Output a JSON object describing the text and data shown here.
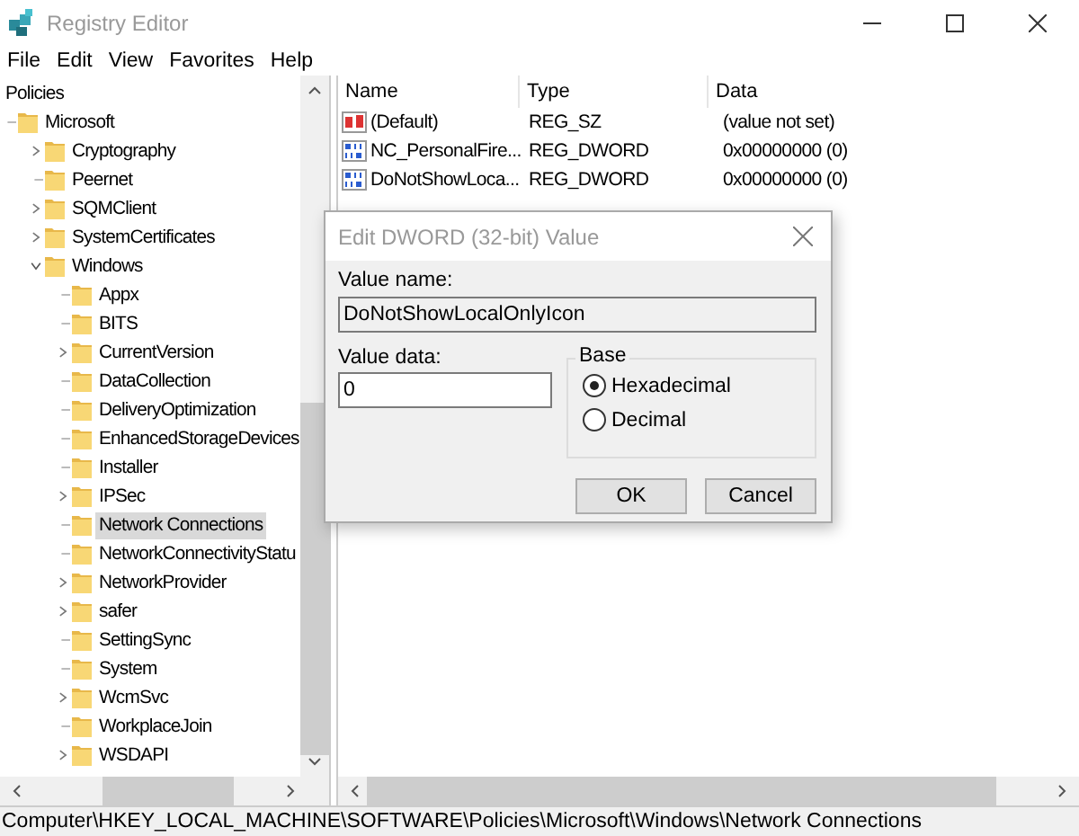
{
  "window": {
    "title": "Registry Editor"
  },
  "menu": [
    "File",
    "Edit",
    "View",
    "Favorites",
    "Help"
  ],
  "tree": [
    {
      "label": "Policies",
      "selected": false,
      "children": [
        {
          "label": "Microsoft",
          "selected": false,
          "children": [
            {
              "label": "Cryptography",
              "expandable": true,
              "expanded": false,
              "selected": false
            },
            {
              "label": "Peernet",
              "expandable": false,
              "expanded": false,
              "selected": false
            },
            {
              "label": "SQMClient",
              "expandable": true,
              "expanded": false,
              "selected": false
            },
            {
              "label": "SystemCertificates",
              "expandable": true,
              "expanded": false,
              "selected": false
            },
            {
              "label": "Windows",
              "expandable": true,
              "expanded": true,
              "selected": false,
              "children": [
                {
                  "label": "Appx",
                  "expandable": false,
                  "expanded": false,
                  "selected": false
                },
                {
                  "label": "BITS",
                  "expandable": false,
                  "expanded": false,
                  "selected": false
                },
                {
                  "label": "CurrentVersion",
                  "expandable": true,
                  "expanded": false,
                  "selected": false
                },
                {
                  "label": "DataCollection",
                  "expandable": false,
                  "expanded": false,
                  "selected": false
                },
                {
                  "label": "DeliveryOptimization",
                  "expandable": false,
                  "expanded": false,
                  "selected": false
                },
                {
                  "label": "EnhancedStorageDevices",
                  "expandable": false,
                  "expanded": false,
                  "selected": false
                },
                {
                  "label": "Installer",
                  "expandable": false,
                  "expanded": false,
                  "selected": false
                },
                {
                  "label": "IPSec",
                  "expandable": true,
                  "expanded": false,
                  "selected": false
                },
                {
                  "label": "Network Connections",
                  "expandable": false,
                  "expanded": false,
                  "selected": true
                },
                {
                  "label": "NetworkConnectivityStatu",
                  "expandable": false,
                  "expanded": false,
                  "selected": false
                },
                {
                  "label": "NetworkProvider",
                  "expandable": true,
                  "expanded": false,
                  "selected": false
                },
                {
                  "label": "safer",
                  "expandable": true,
                  "expanded": false,
                  "selected": false
                },
                {
                  "label": "SettingSync",
                  "expandable": false,
                  "expanded": false,
                  "selected": false
                },
                {
                  "label": "System",
                  "expandable": false,
                  "expanded": false,
                  "selected": false
                },
                {
                  "label": "WcmSvc",
                  "expandable": true,
                  "expanded": false,
                  "selected": false
                },
                {
                  "label": "WorkplaceJoin",
                  "expandable": false,
                  "expanded": false,
                  "selected": false
                },
                {
                  "label": "WSDAPI",
                  "expandable": true,
                  "expanded": false,
                  "selected": false
                }
              ]
            }
          ]
        }
      ]
    }
  ],
  "table": {
    "columns": [
      "Name",
      "Type",
      "Data"
    ],
    "rows": [
      {
        "kind": "string",
        "name": "(Default)",
        "type": "REG_SZ",
        "data": "(value not set)"
      },
      {
        "kind": "binary",
        "name": "NC_PersonalFire...",
        "type": "REG_DWORD",
        "data": "0x00000000 (0)"
      },
      {
        "kind": "binary",
        "name": "DoNotShowLoca...",
        "type": "REG_DWORD",
        "data": "0x00000000 (0)"
      }
    ]
  },
  "dialog": {
    "title": "Edit DWORD (32-bit) Value",
    "value_name_label": "Value name:",
    "value_name": "DoNotShowLocalOnlyIcon",
    "value_data_label": "Value data:",
    "value_data": "0",
    "base_label": "Base",
    "base_options": [
      {
        "label": "Hexadecimal",
        "selected": true
      },
      {
        "label": "Decimal",
        "selected": false
      }
    ],
    "buttons": [
      "OK",
      "Cancel"
    ]
  },
  "status_bar": "Computer\\HKEY_LOCAL_MACHINE\\SOFTWARE\\Policies\\Microsoft\\Windows\\Network Connections"
}
